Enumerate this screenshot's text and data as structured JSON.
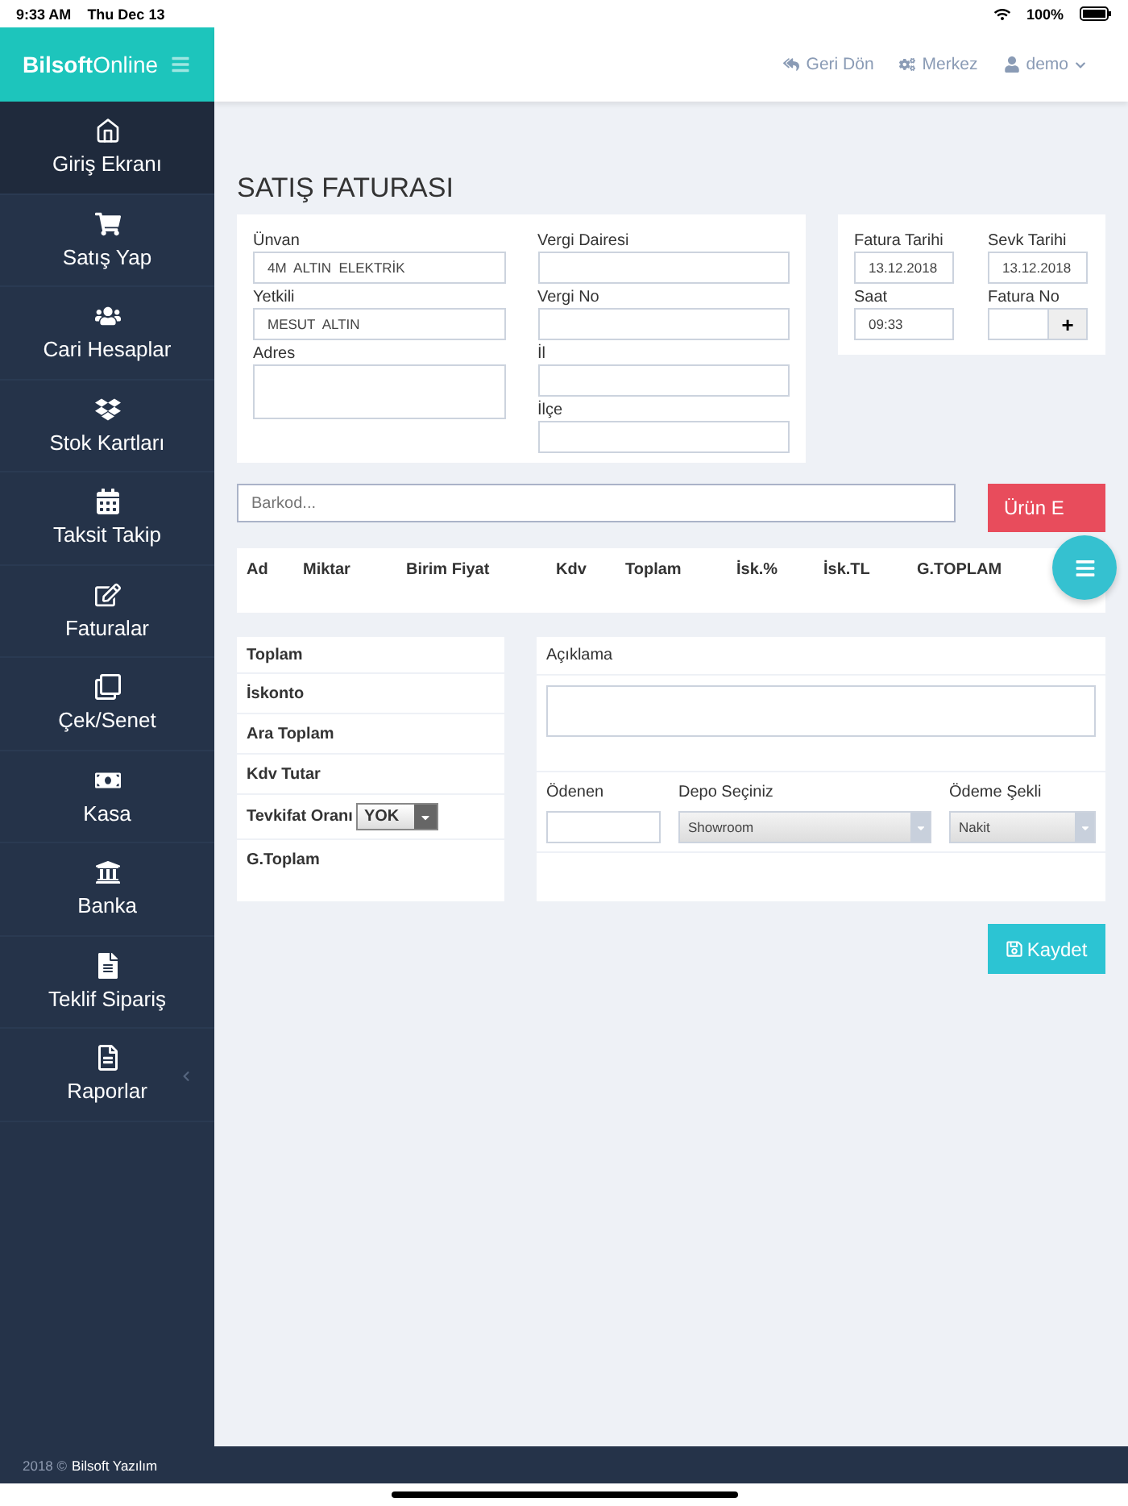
{
  "status_bar": {
    "time": "9:33 AM",
    "date": "Thu Dec 13",
    "battery": "100%"
  },
  "logo": {
    "text": "**Bilsoft**Online"
  },
  "header": {
    "links": [
      {
        "label": "Geri Dön"
      },
      {
        "label": "Merkez"
      },
      {
        "label": "demo"
      }
    ]
  },
  "sidebar": {
    "items": [
      {
        "label": "Giriş Ekranı",
        "selected": true
      },
      {
        "label": "Satış Yap",
        "selected": false
      },
      {
        "label": "Cari Hesaplar",
        "selected": false
      },
      {
        "label": "Stok Kartları",
        "selected": false
      },
      {
        "label": "Taksit Takip",
        "selected": false
      },
      {
        "label": "Faturalar",
        "selected": false
      },
      {
        "label": "Çek/Senet",
        "selected": false
      },
      {
        "label": "Kasa",
        "selected": false
      },
      {
        "label": "Banka",
        "selected": false
      },
      {
        "label": "Teklif Sipariş",
        "selected": false
      },
      {
        "label": "Raporlar",
        "selected": false
      }
    ]
  },
  "page_title": "SATIŞ FATURASI",
  "customer": {
    "left": [
      {
        "label": "Ünvan",
        "value": "4M  ALTIN  ELEKTRİK",
        "kind": "input"
      },
      {
        "label": "Yetkili",
        "value": "MESUT  ALTIN",
        "kind": "input"
      },
      {
        "label": "Adres",
        "kind": "textarea"
      }
    ],
    "right": [
      {
        "label": "Vergi Dairesi"
      },
      {
        "label": "Vergi No"
      },
      {
        "label": "İl"
      },
      {
        "label": "İlçe"
      }
    ]
  },
  "invoice": {
    "fatura_tarihi": {
      "label": "Fatura Tarihi",
      "value": "13.12.2018"
    },
    "sevk_tarihi": {
      "label": "Sevk Tarihi",
      "value": "13.12.2018"
    },
    "saat": {
      "label": "Saat",
      "value": "09:33"
    },
    "fatura_no": {
      "label": "Fatura No",
      "button": "+"
    }
  },
  "barcode": {
    "placeholder": "Barkod..."
  },
  "add_button": "Ürün E",
  "table": {
    "columns": [
      "Ad",
      "Miktar",
      "Birim Fiyat",
      "Kdv",
      "Toplam",
      "İsk.%",
      "İsk.TL",
      "G.TOPLAM"
    ]
  },
  "totals": [
    {
      "label": "Toplam"
    },
    {
      "label": "İskonto"
    },
    {
      "label": "Ara Toplam"
    },
    {
      "label": "Kdv Tutar"
    },
    {
      "label": "Tevkifat Oranı",
      "select": "YOK"
    },
    {
      "label": "G.Toplam"
    }
  ],
  "notes": {
    "label": "Açıklama"
  },
  "payment": {
    "paid": {
      "label": "Ödenen"
    },
    "warehouse": {
      "label": "Depo Seçiniz",
      "value": "Showroom"
    },
    "method": {
      "label": "Ödeme Şekli",
      "value": "Nakit"
    }
  },
  "save_button": "Kaydet",
  "footer": {
    "year": "2018 ©",
    "company": "Bilsoft Yazılım"
  }
}
